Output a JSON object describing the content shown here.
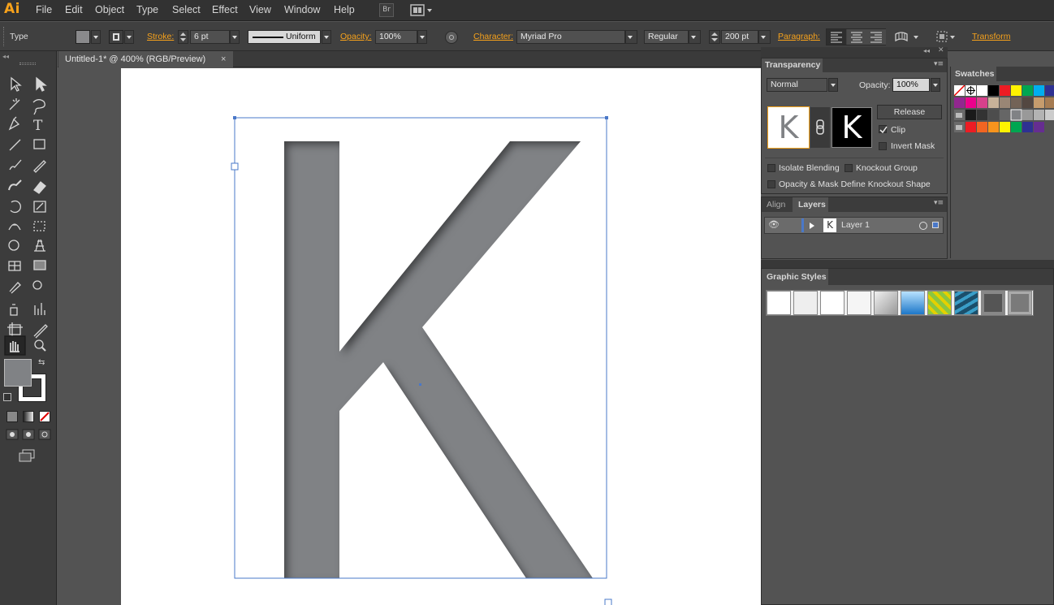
{
  "app": {
    "logo": "Ai"
  },
  "menu": [
    "File",
    "Edit",
    "Object",
    "Type",
    "Select",
    "Effect",
    "View",
    "Window",
    "Help"
  ],
  "menu_buttons": {
    "bridge": "Br"
  },
  "control_bar": {
    "selection_label": "Type",
    "stroke_label": "Stroke:",
    "stroke_weight": "6 pt",
    "stroke_profile": "Uniform",
    "opacity_label": "Opacity:",
    "opacity_value": "100%",
    "character_label": "Character:",
    "font_family": "Myriad Pro",
    "font_style": "Regular",
    "font_size": "200 pt",
    "paragraph_label": "Paragraph:",
    "transform_label": "Transform"
  },
  "document": {
    "tab_title": "Untitled-1* @ 400% (RGB/Preview)",
    "close_glyph": "×",
    "glyph": "K",
    "fill_color": "#808285"
  },
  "transparency_panel": {
    "title": "Transparency",
    "blend_mode": "Normal",
    "opacity_label": "Opacity:",
    "opacity_value": "100%",
    "release_button": "Release",
    "clip_label": "Clip",
    "clip_checked": true,
    "invert_mask_label": "Invert Mask",
    "isolate_blending_label": "Isolate Blending",
    "knockout_group_label": "Knockout Group",
    "opacity_mask_label": "Opacity & Mask Define Knockout Shape",
    "thumb_glyph": "K"
  },
  "layers_panel": {
    "tabs": [
      "Align",
      "Layers"
    ],
    "layer_name": "Layer 1",
    "thumb_glyph": "K"
  },
  "swatches_panel": {
    "title": "Swatches"
  },
  "graphic_styles_panel": {
    "title": "Graphic Styles"
  },
  "colors": {
    "accent": "#f7a21b",
    "selection": "#4a78c8"
  }
}
